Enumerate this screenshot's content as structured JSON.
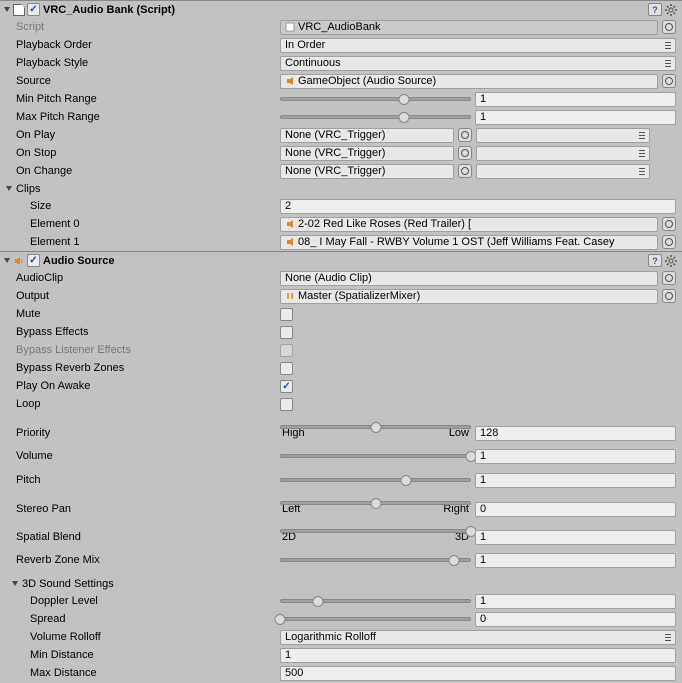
{
  "comp1": {
    "title": "VRC_Audio Bank (Script)",
    "script": {
      "label": "Script",
      "value": "VRC_AudioBank"
    },
    "playbackOrder": {
      "label": "Playback Order",
      "value": "In Order"
    },
    "playbackStyle": {
      "label": "Playback Style",
      "value": "Continuous"
    },
    "source": {
      "label": "Source",
      "value": "GameObject (Audio Source)"
    },
    "minPitch": {
      "label": "Min Pitch Range",
      "value": "1",
      "pos": 65
    },
    "maxPitch": {
      "label": "Max Pitch Range",
      "value": "1",
      "pos": 65
    },
    "onPlay": {
      "label": "On Play",
      "value": "None (VRC_Trigger)"
    },
    "onStop": {
      "label": "On Stop",
      "value": "None (VRC_Trigger)"
    },
    "onChange": {
      "label": "On Change",
      "value": "None (VRC_Trigger)"
    },
    "clips": {
      "label": "Clips",
      "size": {
        "label": "Size",
        "value": "2"
      },
      "el0": {
        "label": "Element 0",
        "value": "2-02 Red Like Roses (Red Trailer) ["
      },
      "el1": {
        "label": "Element 1",
        "value": "08_ I May Fall - RWBY Volume 1 OST (Jeff Williams Feat. Casey"
      }
    }
  },
  "comp2": {
    "title": "Audio Source",
    "audioClip": {
      "label": "AudioClip",
      "value": "None (Audio Clip)"
    },
    "output": {
      "label": "Output",
      "value": "Master (SpatializerMixer)"
    },
    "mute": {
      "label": "Mute"
    },
    "bypassEffects": {
      "label": "Bypass Effects"
    },
    "bypassListener": {
      "label": "Bypass Listener Effects"
    },
    "bypassReverb": {
      "label": "Bypass Reverb Zones"
    },
    "playOnAwake": {
      "label": "Play On Awake"
    },
    "loop": {
      "label": "Loop"
    },
    "priority": {
      "label": "Priority",
      "value": "128",
      "pos": 50,
      "left": "High",
      "right": "Low"
    },
    "volume": {
      "label": "Volume",
      "value": "1",
      "pos": 100
    },
    "pitch": {
      "label": "Pitch",
      "value": "1",
      "pos": 66
    },
    "stereoPan": {
      "label": "Stereo Pan",
      "value": "0",
      "pos": 50,
      "left": "Left",
      "right": "Right"
    },
    "spatialBlend": {
      "label": "Spatial Blend",
      "value": "1",
      "pos": 100,
      "left": "2D",
      "right": "3D"
    },
    "reverbZoneMix": {
      "label": "Reverb Zone Mix",
      "value": "1",
      "pos": 91
    },
    "sound3d": {
      "label": "3D Sound Settings",
      "doppler": {
        "label": "Doppler Level",
        "value": "1",
        "pos": 20
      },
      "spread": {
        "label": "Spread",
        "value": "0",
        "pos": 0
      },
      "rolloff": {
        "label": "Volume Rolloff",
        "value": "Logarithmic Rolloff"
      },
      "minDist": {
        "label": "Min Distance",
        "value": "1"
      },
      "maxDist": {
        "label": "Max Distance",
        "value": "500"
      }
    }
  }
}
